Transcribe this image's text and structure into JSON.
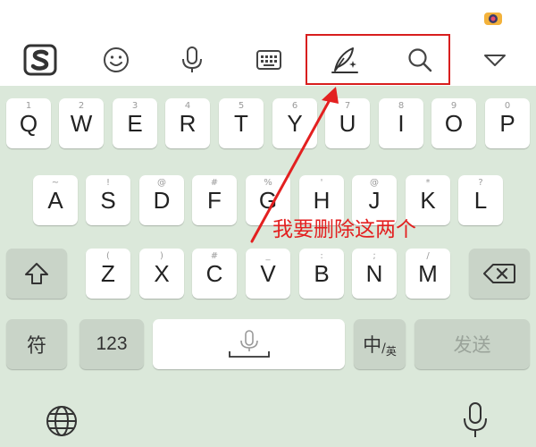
{
  "toolbar": {
    "icons": [
      "sogou-logo-icon",
      "emoji-icon",
      "microphone-icon",
      "keyboard-icon",
      "handwriting-quill-icon",
      "search-icon",
      "collapse-triangle-icon"
    ]
  },
  "rows": {
    "row1": [
      {
        "main": "Q",
        "sub": "1"
      },
      {
        "main": "W",
        "sub": "2"
      },
      {
        "main": "E",
        "sub": "3"
      },
      {
        "main": "R",
        "sub": "4"
      },
      {
        "main": "T",
        "sub": "5"
      },
      {
        "main": "Y",
        "sub": "6"
      },
      {
        "main": "U",
        "sub": "7"
      },
      {
        "main": "I",
        "sub": "8"
      },
      {
        "main": "O",
        "sub": "9"
      },
      {
        "main": "P",
        "sub": "0"
      }
    ],
    "row2": [
      {
        "main": "A",
        "sub": "~"
      },
      {
        "main": "S",
        "sub": "!"
      },
      {
        "main": "D",
        "sub": "@"
      },
      {
        "main": "F",
        "sub": "#"
      },
      {
        "main": "G",
        "sub": "%"
      },
      {
        "main": "H",
        "sub": "'"
      },
      {
        "main": "J",
        "sub": "@"
      },
      {
        "main": "K",
        "sub": "*"
      },
      {
        "main": "L",
        "sub": "?"
      }
    ],
    "row3": [
      {
        "main": "Z",
        "sub": "("
      },
      {
        "main": "X",
        "sub": ")"
      },
      {
        "main": "C",
        "sub": "#"
      },
      {
        "main": "V",
        "sub": "_"
      },
      {
        "main": "B",
        "sub": ":"
      },
      {
        "main": "N",
        "sub": ";"
      },
      {
        "main": "M",
        "sub": "/"
      }
    ]
  },
  "function_keys": {
    "symbol_label": "符",
    "numbers_label": "123",
    "lang_main": "中",
    "lang_sep": "/",
    "lang_sub": "英",
    "send_label": "发送"
  },
  "annotation_text": "我要删除这两个",
  "colors": {
    "keyboard_bg": "#dbe8da",
    "function_key_bg": "#c9d4c8",
    "annotation_red": "#e32020",
    "toolbar_bg": "#ffffff"
  }
}
